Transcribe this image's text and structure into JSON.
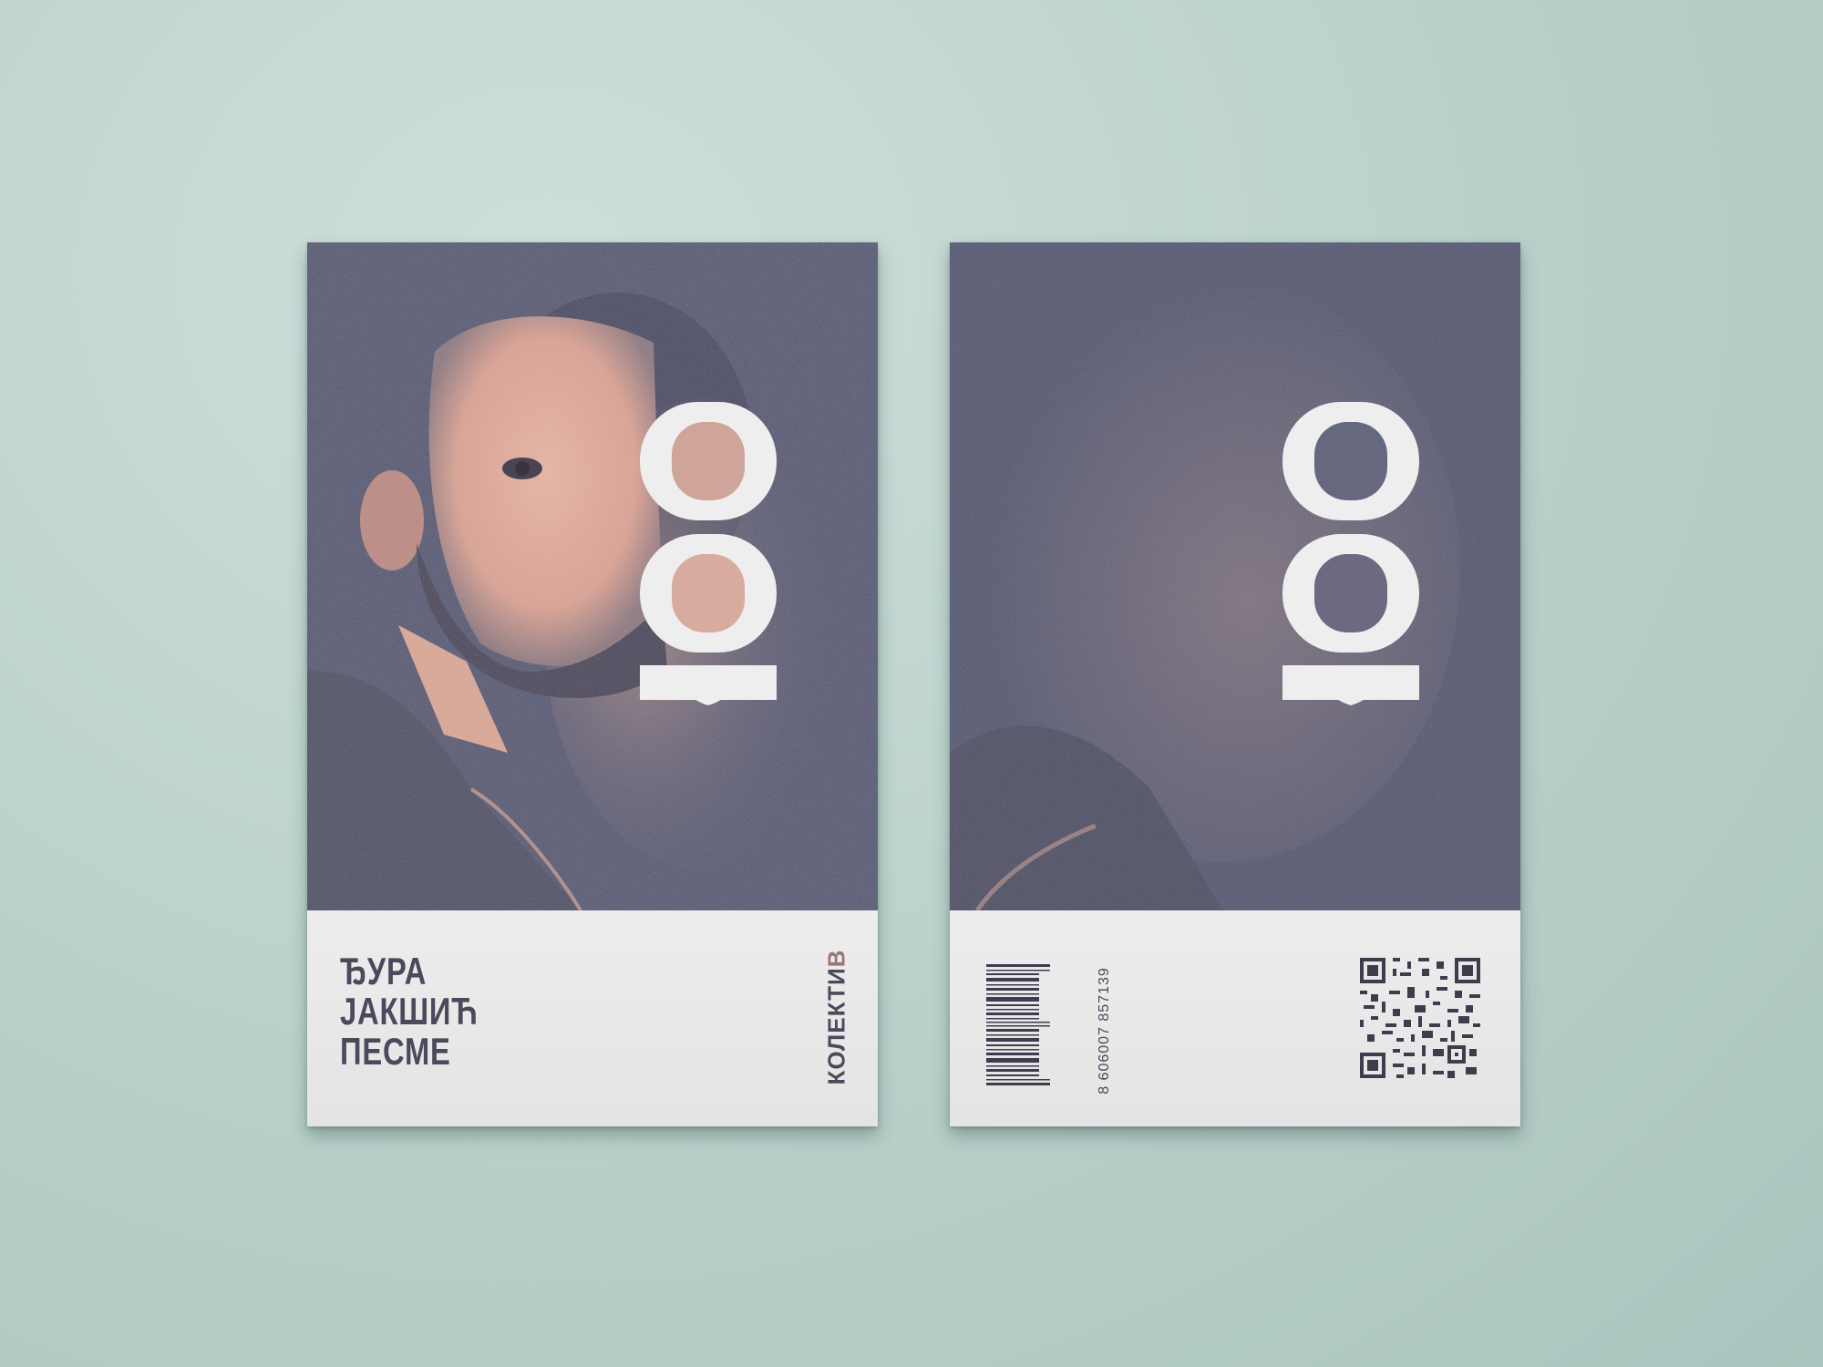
{
  "front": {
    "mark": "100",
    "title_lines": [
      "ЂУРА",
      "ЈАКШИЋ",
      "ПЕСМЕ"
    ],
    "publisher": {
      "main": "КОЛЕКТИ",
      "accent": "В"
    }
  },
  "back": {
    "mark": "100",
    "barcode_number": "8 606007 857139",
    "qr_label": "qr-code"
  },
  "colors": {
    "background": "#b9d0ca",
    "cover_dark": "#5b5e77",
    "accent_pink": "#d9a99a",
    "text": "#4a4a5c"
  }
}
